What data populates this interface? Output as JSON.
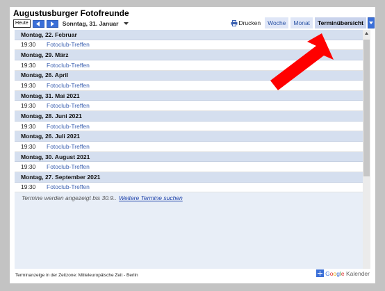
{
  "calendar": {
    "title": "Augustusburger Fotofreunde",
    "today_label": "Heute",
    "prev_icon": "chevron-left-icon",
    "next_icon": "chevron-right-icon",
    "current_date": "Sonntag, 31. Januar"
  },
  "toolbar": {
    "print_label": "Drucken",
    "views": [
      "Woche",
      "Monat",
      "Terminübersicht"
    ],
    "active_view": "Terminübersicht"
  },
  "agenda": {
    "days": [
      {
        "date": "Montag, 22. Februar",
        "time": "19:30",
        "title": "Fotoclub-Treffen"
      },
      {
        "date": "Montag, 29. März",
        "time": "19:30",
        "title": "Fotoclub-Treffen"
      },
      {
        "date": "Montag, 26. April",
        "time": "19:30",
        "title": "Fotoclub-Treffen"
      },
      {
        "date": "Montag, 31. Mai 2021",
        "time": "19:30",
        "title": "Fotoclub-Treffen"
      },
      {
        "date": "Montag, 28. Juni 2021",
        "time": "19:30",
        "title": "Fotoclub-Treffen"
      },
      {
        "date": "Montag, 26. Juli 2021",
        "time": "19:30",
        "title": "Fotoclub-Treffen"
      },
      {
        "date": "Montag, 30. August 2021",
        "time": "19:30",
        "title": "Fotoclub-Treffen"
      },
      {
        "date": "Montag, 27. September 2021",
        "time": "19:30",
        "title": "Fotoclub-Treffen"
      }
    ],
    "range_note": "Termine werden angezeigt bis 30.9..",
    "more_link": "Weitere Termine suchen"
  },
  "footer": {
    "timezone_note": "Terminanzeige in der Zeitzone: Mitteleuropäische Zeit - Berlin",
    "google_logo": {
      "part1": "Google",
      "part2": "Kalender"
    }
  },
  "colors": {
    "accent": "#3a6fd8",
    "day_header_bg": "#d5dfef",
    "link": "#3a5fb0",
    "annotation_arrow": "#ff0000",
    "page_bg": "#c3c3c3"
  }
}
